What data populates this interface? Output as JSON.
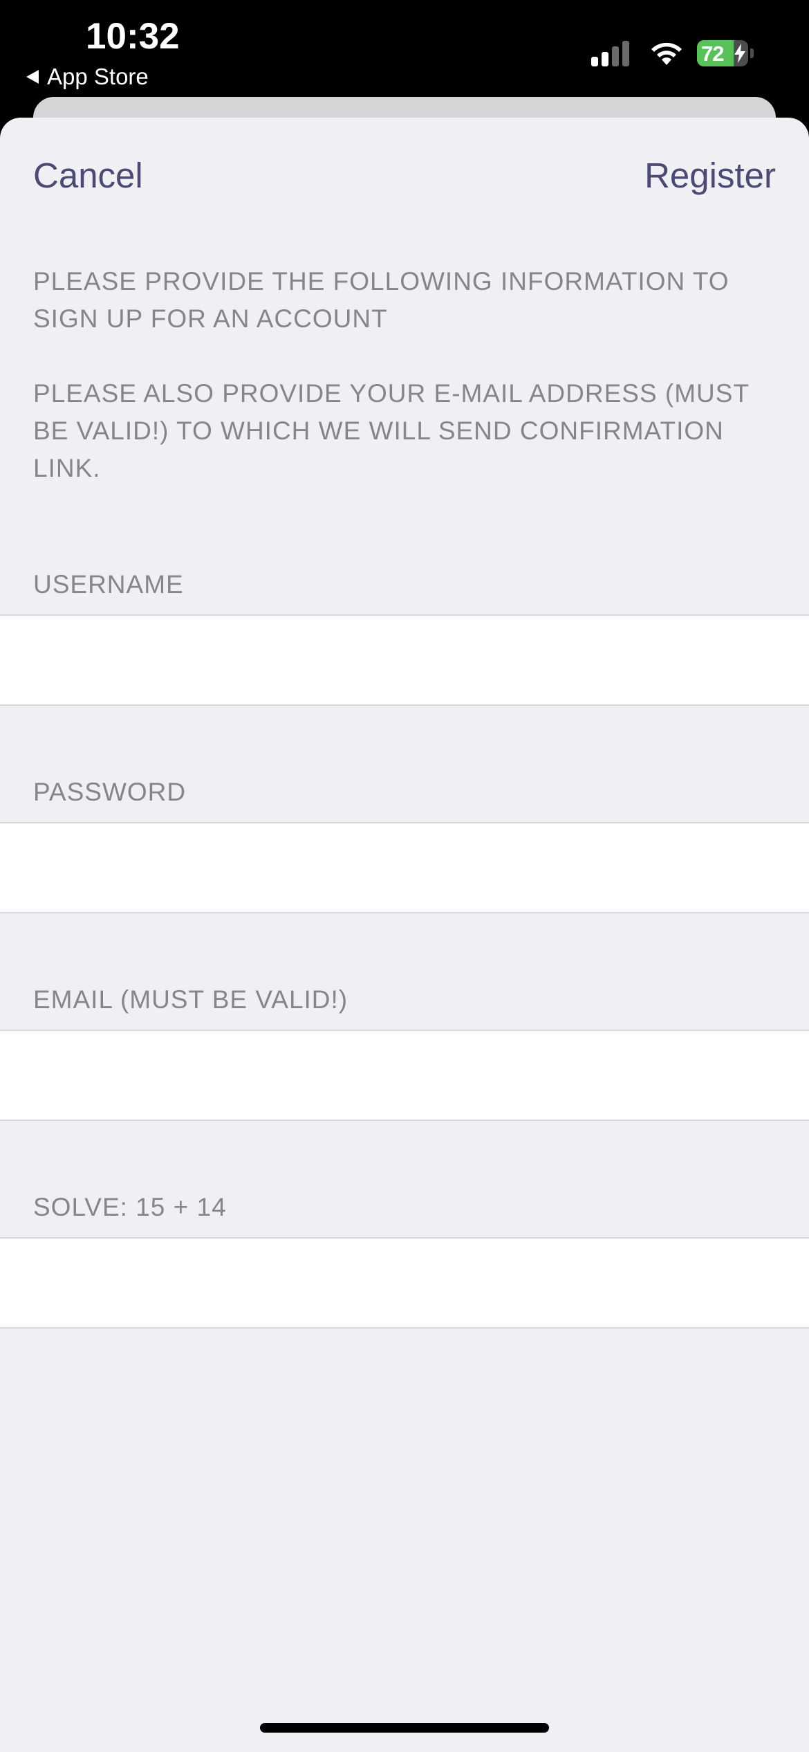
{
  "status_bar": {
    "time": "10:32",
    "back_app_label": "App Store",
    "battery_percent": "72",
    "battery_level": 0.72,
    "signal_bars_active": 2,
    "signal_bars_total": 4,
    "charging": true,
    "icons": [
      "back-arrow-icon",
      "cellular-signal-icon",
      "wifi-icon",
      "battery-icon",
      "charging-bolt-icon"
    ]
  },
  "nav": {
    "cancel_label": "Cancel",
    "register_label": "Register"
  },
  "info": {
    "line_1": "PLEASE PROVIDE THE FOLLOWING INFORMATION TO SIGN UP FOR AN ACCOUNT",
    "line_2": "PLEASE ALSO PROVIDE YOUR E-MAIL ADDRESS (MUST BE VALID!) TO WHICH WE WILL SEND CONFIRMATION LINK."
  },
  "form": {
    "username": {
      "label": "USERNAME",
      "value": ""
    },
    "password": {
      "label": "PASSWORD",
      "value": ""
    },
    "email": {
      "label": "EMAIL (MUST BE VALID!)",
      "value": ""
    },
    "captcha": {
      "label": "SOLVE: 15 + 14",
      "value": ""
    }
  },
  "colors": {
    "accent": "#4a4a73",
    "sheet_background": "#f0eff4",
    "secondary_text": "#86858b",
    "battery_green": "#5ac05a"
  }
}
